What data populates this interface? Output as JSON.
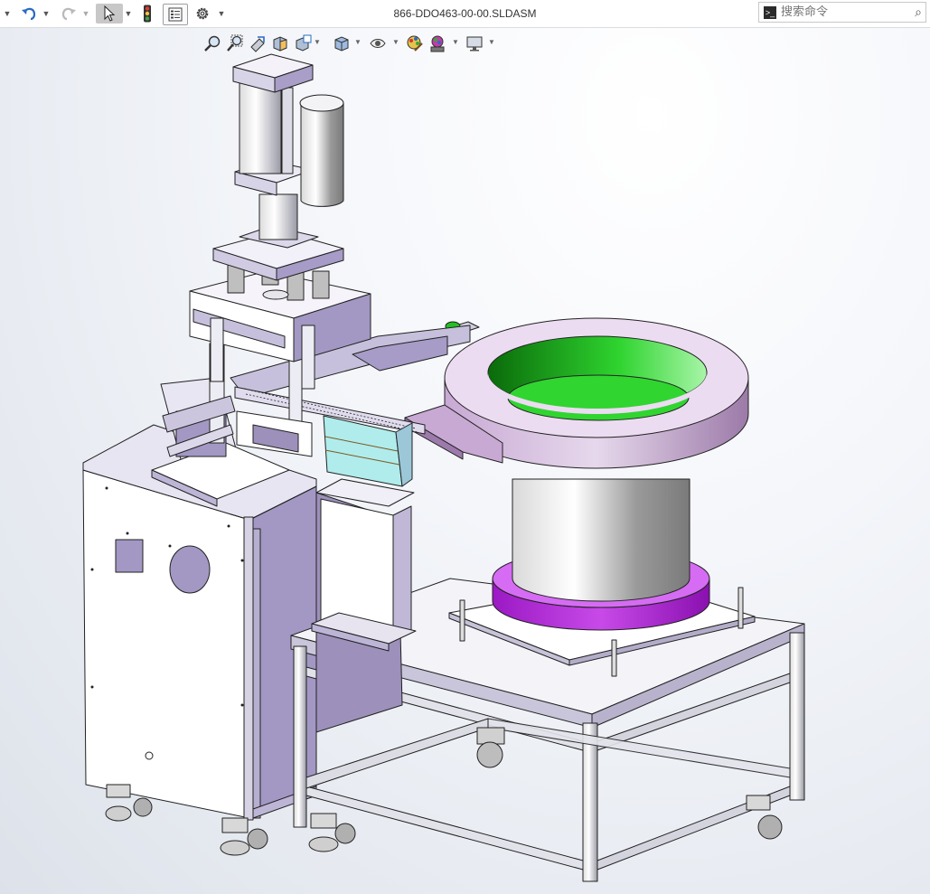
{
  "window": {
    "title": "866-DDO463-00-00.SLDASM"
  },
  "toolbar": {
    "undo_icon": "undo-icon",
    "redo_icon": "redo-icon",
    "select_icon": "cursor-arrow-icon",
    "rebuild_icon": "traffic-light-icon",
    "file_properties_icon": "file-properties-icon",
    "options_icon": "gear-icon"
  },
  "search": {
    "placeholder": "搜索命令"
  },
  "view_toolbar": [
    "zoom-to-fit-icon",
    "zoom-to-area-icon",
    "previous-view-icon",
    "section-view-icon",
    "dynamic-annotation-icon",
    "view-orientation-icon",
    "display-style-icon",
    "hide-show-items-icon",
    "edit-appearance-icon",
    "apply-scene-icon",
    "view-settings-icon"
  ],
  "colors": {
    "frame": "#d9d5e8",
    "frame_dark": "#9d90bb",
    "aluminum": "#c9c9cf",
    "bowl_outer": "#c8a9d4",
    "bowl_inner": "#2fd42f",
    "bowl_base": "#b020d8",
    "button_green": "#22c022",
    "cyan": "#b0ecec"
  }
}
